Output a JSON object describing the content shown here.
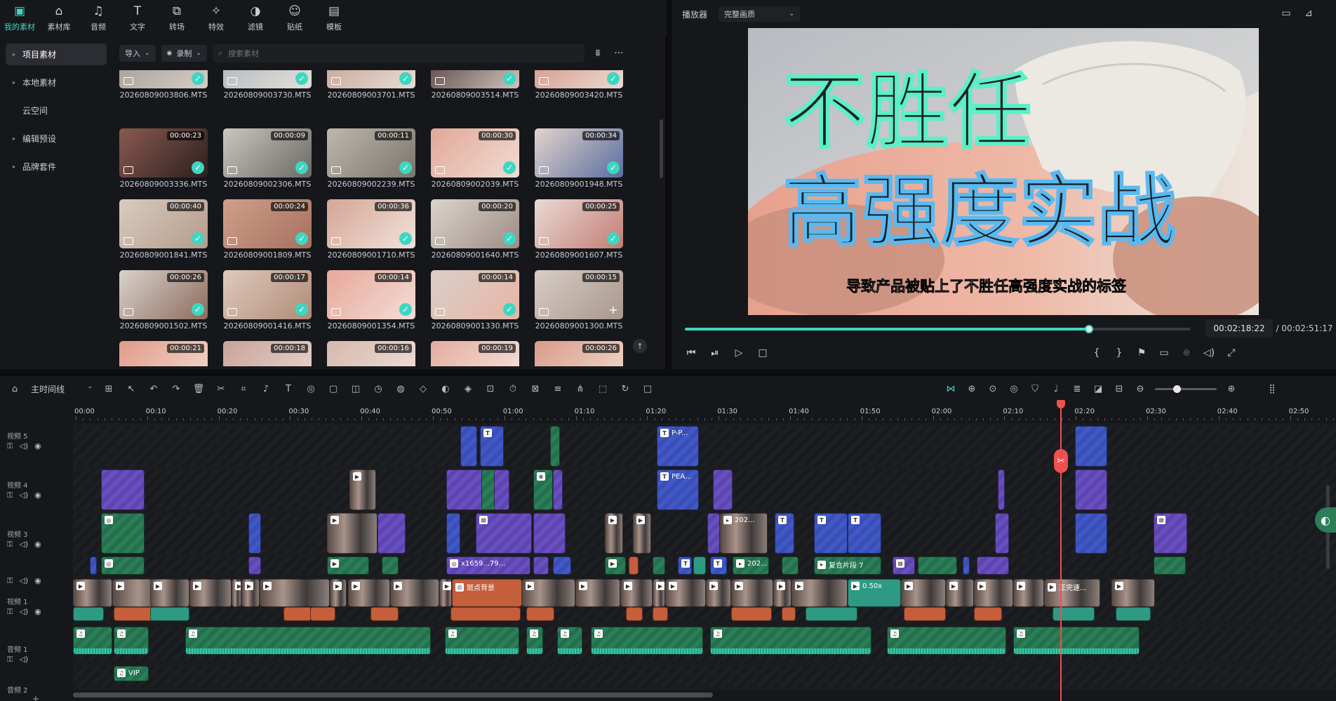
{
  "top_tabs": [
    {
      "label": "我的素材",
      "icon": "my-media-icon",
      "glyph": "▣",
      "active": true
    },
    {
      "label": "素材库",
      "icon": "stock-library-icon",
      "glyph": "⌂"
    },
    {
      "label": "音频",
      "icon": "music-icon",
      "glyph": "♫"
    },
    {
      "label": "文字",
      "icon": "text-icon",
      "glyph": "T"
    },
    {
      "label": "转场",
      "icon": "transition-icon",
      "glyph": "⧉"
    },
    {
      "label": "特效",
      "icon": "effects-icon",
      "glyph": "✧"
    },
    {
      "label": "滤镜",
      "icon": "filter-icon",
      "glyph": "◑"
    },
    {
      "label": "贴纸",
      "icon": "sticker-icon",
      "glyph": "☺"
    },
    {
      "label": "模板",
      "icon": "template-icon",
      "glyph": "▤"
    }
  ],
  "sidebar": [
    {
      "label": "项目素材",
      "arrow": "▸",
      "active": true
    },
    {
      "label": "本地素材",
      "arrow": "▸"
    },
    {
      "label": "云空间",
      "arrow": ""
    },
    {
      "label": "编辑预设",
      "arrow": "▸"
    },
    {
      "label": "品牌套件",
      "arrow": "▸"
    }
  ],
  "media_toolbar": {
    "import_label": "导入",
    "record_label": "录制",
    "search_placeholder": "搜索素材"
  },
  "media_items": [
    {
      "name": "20260809003806.MTS",
      "duration": "",
      "checked": true,
      "colors": [
        "#a79f9a",
        "#d8cdc6"
      ]
    },
    {
      "name": "20260809003730.MTS",
      "duration": "",
      "checked": true,
      "colors": [
        "#b5b9bd",
        "#e2e0dc"
      ]
    },
    {
      "name": "20260809003701.MTS",
      "duration": "",
      "checked": true,
      "colors": [
        "#c8a79a",
        "#e7dcd4"
      ]
    },
    {
      "name": "20260809003514.MTS",
      "duration": "",
      "checked": true,
      "colors": [
        "#5d4b49",
        "#cfc3bb"
      ]
    },
    {
      "name": "20260809003420.MTS",
      "duration": "",
      "checked": true,
      "colors": [
        "#d59c8c",
        "#eadad2"
      ]
    },
    {
      "name": "20260809003336.MTS",
      "duration": "00:00:23",
      "checked": true,
      "colors": [
        "#8a5a4f",
        "#2b1f1f"
      ]
    },
    {
      "name": "20260809002306.MTS",
      "duration": "00:00:09",
      "checked": true,
      "colors": [
        "#c9c6bf",
        "#6c6a66"
      ]
    },
    {
      "name": "20260809002239.MTS",
      "duration": "00:00:11",
      "checked": true,
      "colors": [
        "#bdb8ad",
        "#7a766e"
      ]
    },
    {
      "name": "20260809002039.MTS",
      "duration": "00:00:30",
      "checked": true,
      "colors": [
        "#e1a897",
        "#f0dcd3"
      ]
    },
    {
      "name": "20260809001948.MTS",
      "duration": "00:00:34",
      "checked": true,
      "colors": [
        "#e3d3cc",
        "#5a6ea0"
      ]
    },
    {
      "name": "20260809001841.MTS",
      "duration": "00:00:40",
      "checked": true,
      "colors": [
        "#d8cbbf",
        "#b49b8a"
      ]
    },
    {
      "name": "20260809001809.MTS",
      "duration": "00:00:24",
      "checked": true,
      "colors": [
        "#cf9f8b",
        "#a77060"
      ]
    },
    {
      "name": "20260809001710.MTS",
      "duration": "00:00:36",
      "checked": true,
      "colors": [
        "#d4a595",
        "#f1e2da"
      ]
    },
    {
      "name": "20260809001640.MTS",
      "duration": "00:00:20",
      "checked": true,
      "colors": [
        "#dcd3cd",
        "#9c8d84"
      ]
    },
    {
      "name": "20260809001607.MTS",
      "duration": "00:00:25",
      "checked": true,
      "colors": [
        "#e9dad3",
        "#c27d74"
      ]
    },
    {
      "name": "20260809001502.MTS",
      "duration": "00:00:26",
      "checked": true,
      "colors": [
        "#d9d2cc",
        "#8d6b5d"
      ]
    },
    {
      "name": "20260809001416.MTS",
      "duration": "00:00:17",
      "checked": true,
      "colors": [
        "#dfc9bc",
        "#b08b78"
      ]
    },
    {
      "name": "20260809001354.MTS",
      "duration": "00:00:14",
      "checked": true,
      "colors": [
        "#e8a79b",
        "#f2ddd5"
      ]
    },
    {
      "name": "20260809001330.MTS",
      "duration": "00:00:14",
      "checked": true,
      "colors": [
        "#d9cfc8",
        "#e7b5a5"
      ]
    },
    {
      "name": "20260809001300.MTS",
      "duration": "00:00:15",
      "checked": false,
      "colors": [
        "#d7cdc6",
        "#a8978c"
      ]
    },
    {
      "name": "",
      "duration": "00:00:21",
      "checked": false,
      "colors": [
        "#e19b87",
        "#f2dbd1"
      ]
    },
    {
      "name": "",
      "duration": "00:00:18",
      "checked": false,
      "colors": [
        "#c9a39a",
        "#e8d7cf"
      ]
    },
    {
      "name": "",
      "duration": "00:00:16",
      "checked": false,
      "colors": [
        "#d6b8ac",
        "#efe1da"
      ]
    },
    {
      "name": "",
      "duration": "00:00:19",
      "checked": false,
      "colors": [
        "#e3ada0",
        "#f4e4dd"
      ]
    },
    {
      "name": "",
      "duration": "00:00:26",
      "checked": false,
      "colors": [
        "#d99c88",
        "#f0dacf"
      ]
    }
  ],
  "player": {
    "title": "播放器",
    "quality": "完整画质",
    "video": {
      "title_line1": "不胜任",
      "title_line2": "高强度实战",
      "subtitle": "导致产品被贴上了不胜任高强度实战的标签"
    },
    "current_time": "00:02:18:22",
    "total_time": "/ 00:02:51:17",
    "progress": 0.8
  },
  "timeline": {
    "name": "主时间线",
    "ruler": [
      "00:00",
      "00:10",
      "00:20",
      "00:30",
      "00:40",
      "00:50",
      "01:00",
      "01:10",
      "01:20",
      "01:30",
      "01:40",
      "01:50",
      "02:00",
      "02:10",
      "02:20",
      "02:30",
      "02:40",
      "02:50"
    ],
    "tracks": [
      "视频 5",
      "视频 4",
      "视频 3",
      "",
      "视频 1",
      "音频 1",
      "音频 2"
    ],
    "clip_labels": {
      "p": "P-P...",
      "pea": "PEA...",
      "c202": "202...",
      "fuhe": "复合片段 7",
      "x1659": "x1659...79...",
      "kongdian": "斑点背景",
      "s50": "0.50x",
      "vip": "VIP",
      "yiyuan": "正完速..."
    }
  }
}
